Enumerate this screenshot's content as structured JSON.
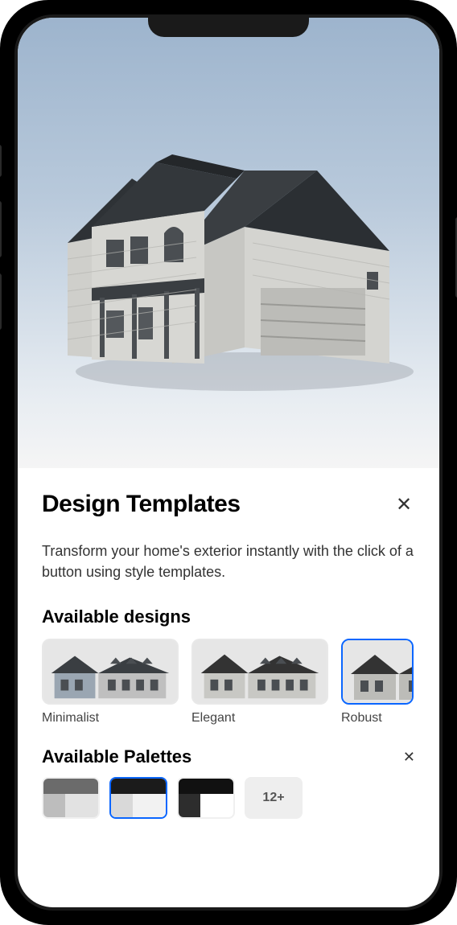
{
  "panel": {
    "title": "Design Templates",
    "description": "Transform your home's exterior instantly with the click of a button using style templates."
  },
  "designs": {
    "heading": "Available designs",
    "items": [
      {
        "label": "Minimalist",
        "selected": false
      },
      {
        "label": "Elegant",
        "selected": false
      },
      {
        "label": "Robust",
        "selected": true
      }
    ]
  },
  "palettes": {
    "heading": "Available Palettes",
    "more_label": "12+",
    "items": [
      {
        "colors": [
          "#6b6b6b",
          "#bdbdbd",
          "#e2e2e2"
        ],
        "selected": false
      },
      {
        "colors": [
          "#1b1b1b",
          "#d9d9d9",
          "#f2f2f2"
        ],
        "selected": true
      },
      {
        "colors": [
          "#111111",
          "#2d2d2d",
          "#ffffff"
        ],
        "selected": false
      }
    ]
  },
  "icons": {
    "close": "✕"
  }
}
